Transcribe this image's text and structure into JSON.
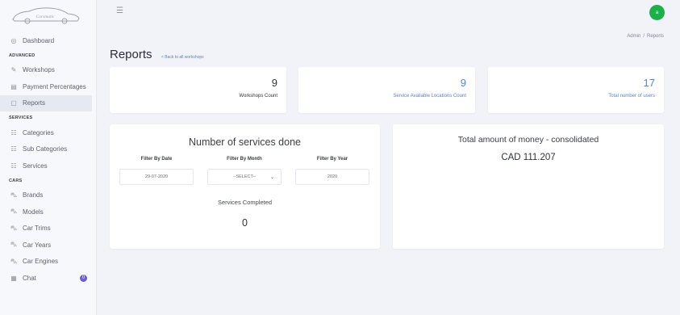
{
  "logo": {
    "icon": "car-logo",
    "text": "Carsmatic"
  },
  "sidebar": {
    "items": [
      {
        "icon": "dashboard-icon",
        "glyph": "◎",
        "label": "Dashboard"
      },
      {
        "section": "ADVANCED"
      },
      {
        "icon": "wrench-icon",
        "glyph": "✎",
        "label": "Workshops"
      },
      {
        "icon": "percent-icon",
        "glyph": "▤",
        "label": "Payment Percentages"
      },
      {
        "icon": "report-icon",
        "glyph": "▢",
        "label": "Reports",
        "active": true
      },
      {
        "section": "SERVICES"
      },
      {
        "icon": "list-icon",
        "glyph": "☷",
        "label": "Categories"
      },
      {
        "icon": "list-icon",
        "glyph": "☷",
        "label": "Sub Categories"
      },
      {
        "icon": "list-icon",
        "glyph": "☷",
        "label": "Services"
      },
      {
        "section": "CARS"
      },
      {
        "icon": "car-icon",
        "glyph": "⛍",
        "label": "Brands"
      },
      {
        "icon": "car-icon",
        "glyph": "⛍",
        "label": "Models"
      },
      {
        "icon": "car-icon",
        "glyph": "⛍",
        "label": "Car Trims"
      },
      {
        "icon": "car-icon",
        "glyph": "⛍",
        "label": "Car Years"
      },
      {
        "icon": "car-icon",
        "glyph": "⛍",
        "label": "Car Engines"
      },
      {
        "icon": "chat-icon",
        "glyph": "▦",
        "label": "Chat",
        "badge": "0"
      }
    ]
  },
  "header": {
    "avatar_initial": "a",
    "breadcrumb": {
      "parent": "Admin",
      "separator": "/",
      "current": "Reports"
    },
    "title": "Reports",
    "back_link": "< Back to all workshops"
  },
  "stats": [
    {
      "value": "9",
      "label": "Workshops Count"
    },
    {
      "value": "9",
      "label": "Service Available Locations Count"
    },
    {
      "value": "17",
      "label": "Total number of users"
    }
  ],
  "services_panel": {
    "title": "Number of services done",
    "filters": [
      {
        "label": "Filter By Date",
        "value": "29-07-2020"
      },
      {
        "label": "Filter By Month",
        "value": "--SELECT--"
      },
      {
        "label": "Filter By Year",
        "value": "2020"
      }
    ],
    "completed_label": "Services Completed",
    "completed_value": "0"
  },
  "money_panel": {
    "title": "Total amount of money - consolidated",
    "value": "CAD 111.207"
  },
  "colors": {
    "accent": "#5b7fd4",
    "avatar": "#1eae4a",
    "badge": "#6f5ad8",
    "active_bg": "#e6e9f1"
  }
}
